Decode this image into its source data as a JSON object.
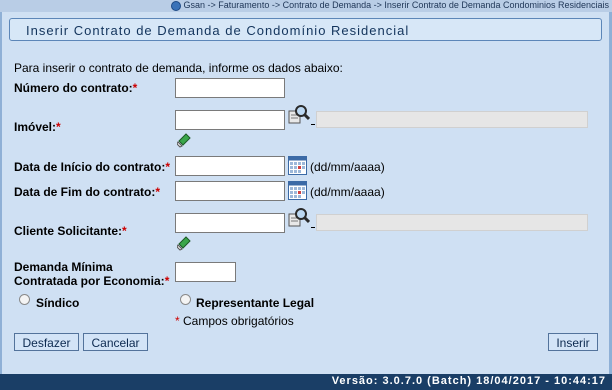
{
  "breadcrumb": {
    "text": "Gsan -> Faturamento -> Contrato de Demanda -> Inserir Contrato de Demanda Condominios Residenciais"
  },
  "page": {
    "title": "Inserir Contrato de Demanda de Condomínio Residencial",
    "intro": "Para inserir o contrato de demanda, informe os dados abaixo:"
  },
  "form": {
    "numero_label": "Número do contrato:",
    "numero_value": "",
    "imovel_label": "Imóvel:",
    "imovel_value": "",
    "imovel_desc": "",
    "data_inicio_label": "Data de Início do contrato:",
    "data_inicio_value": "",
    "data_fim_label": "Data de Fim do contrato:",
    "data_fim_value": "",
    "date_format": "(dd/mm/aaaa)",
    "cliente_label": "Cliente Solicitante:",
    "cliente_value": "",
    "cliente_desc": "",
    "demanda_label_line1": "Demanda Mínima",
    "demanda_label_line2": "Contratada por Economia:",
    "demanda_value": "",
    "required_mark": "*",
    "radio_sindico": "Síndico",
    "radio_representante": "Representante Legal",
    "required_note": "Campos obrigatórios"
  },
  "buttons": {
    "desfazer": "Desfazer",
    "cancelar": "Cancelar",
    "inserir": "Inserir"
  },
  "footer": {
    "version": "Versão: 3.0.7.0 (Batch) 18/04/2017 - 10:44:17"
  },
  "colors": {
    "background": "#cfe0f3",
    "footer": "#1a3e66",
    "required": "#cc0000"
  }
}
